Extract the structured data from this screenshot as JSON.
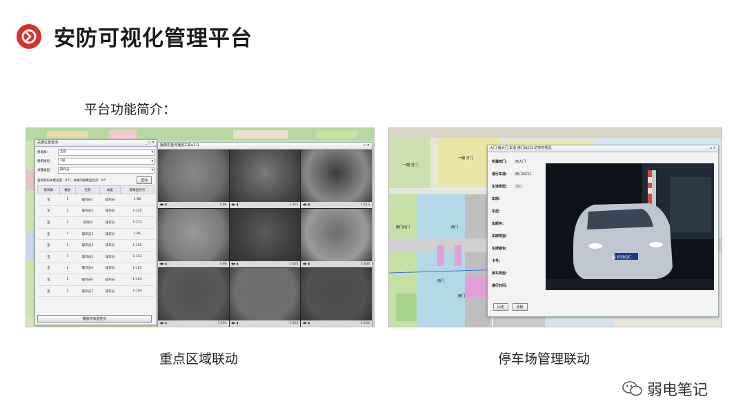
{
  "header": {
    "title": "安防可视化管理平台",
    "accent": "#d9302b"
  },
  "subtitle": "平台功能简介：",
  "left_screenshot": {
    "search_window": {
      "title": "关键位置查询",
      "fields": [
        {
          "label": "建筑群：",
          "value": "宝座"
        },
        {
          "label": "建筑楼层：",
          "value": "1层"
        },
        {
          "label": "关键类型：",
          "value": "操作员"
        }
      ],
      "result_text": "查询到的关键位置：9个，关联的摄像监控点：9个",
      "search_button": "查询",
      "columns": [
        "建筑群",
        "楼层",
        "名称",
        "类型",
        "摄像监控点"
      ],
      "rows": [
        [
          "宝",
          "1",
          "操作员1",
          "操作员",
          "1-88"
        ],
        [
          "宝",
          "1",
          "操作员2",
          "操作员",
          "1-145"
        ],
        [
          "宝",
          "1",
          "洗消间",
          "操作员",
          "1-111"
        ],
        [
          "宝",
          "1",
          "操作员3",
          "操作员",
          "1-95"
        ],
        [
          "宝",
          "1",
          "操作员4",
          "操作员",
          "1-105"
        ],
        [
          "宝",
          "1",
          "操作员5",
          "操作员",
          "1-153"
        ],
        [
          "宝",
          "1",
          "操作员6",
          "操作员",
          "1-101"
        ],
        [
          "宝",
          "1",
          "操作员6",
          "操作员",
          "1-103"
        ],
        [
          "宝",
          "1",
          "操作员7",
          "操作员",
          "1-104"
        ]
      ],
      "footer_button": "播放所有监控点"
    },
    "video_window": {
      "title": "摄像机重点播放工具v1.0",
      "cameras": [
        {
          "tag": "1-88"
        },
        {
          "tag": "1-105"
        },
        {
          "tag": "1-113"
        },
        {
          "tag": "1-90"
        },
        {
          "tag": "1-105"
        },
        {
          "tag": "1-106"
        },
        {
          "tag": "1-101"
        },
        {
          "tag": "1-103"
        },
        {
          "tag": "1-104"
        }
      ]
    }
  },
  "right_screenshot": {
    "map_labels": [
      "一期 万门",
      "一期 万门",
      "南门北门",
      "南门",
      "南门",
      "南门"
    ],
    "dialog": {
      "title": "大门 南大门 车道 南门出口1 的实时情况",
      "fields": [
        {
          "label": "所属校门:",
          "value": "南大门"
        },
        {
          "label": "通行车道:",
          "value": "南门出口1"
        },
        {
          "label": "车道类型:",
          "value": "出口"
        },
        {
          "label": "车牌:",
          "value": ""
        },
        {
          "label": "车型:",
          "value": ""
        },
        {
          "label": "车颜色:",
          "value": ""
        },
        {
          "label": "车牌类型:",
          "value": ""
        },
        {
          "label": "车牌颜色:",
          "value": ""
        },
        {
          "label": "卡号:",
          "value": ""
        },
        {
          "label": "停车类型:",
          "value": ""
        },
        {
          "label": "通行时间:",
          "value": ""
        }
      ],
      "plate": "JA 838QC",
      "buttons": [
        "历史",
        "清除"
      ]
    }
  },
  "captions": {
    "left": "重点区域联动",
    "right": "停车场管理联动"
  },
  "watermark": "弱电笔记"
}
